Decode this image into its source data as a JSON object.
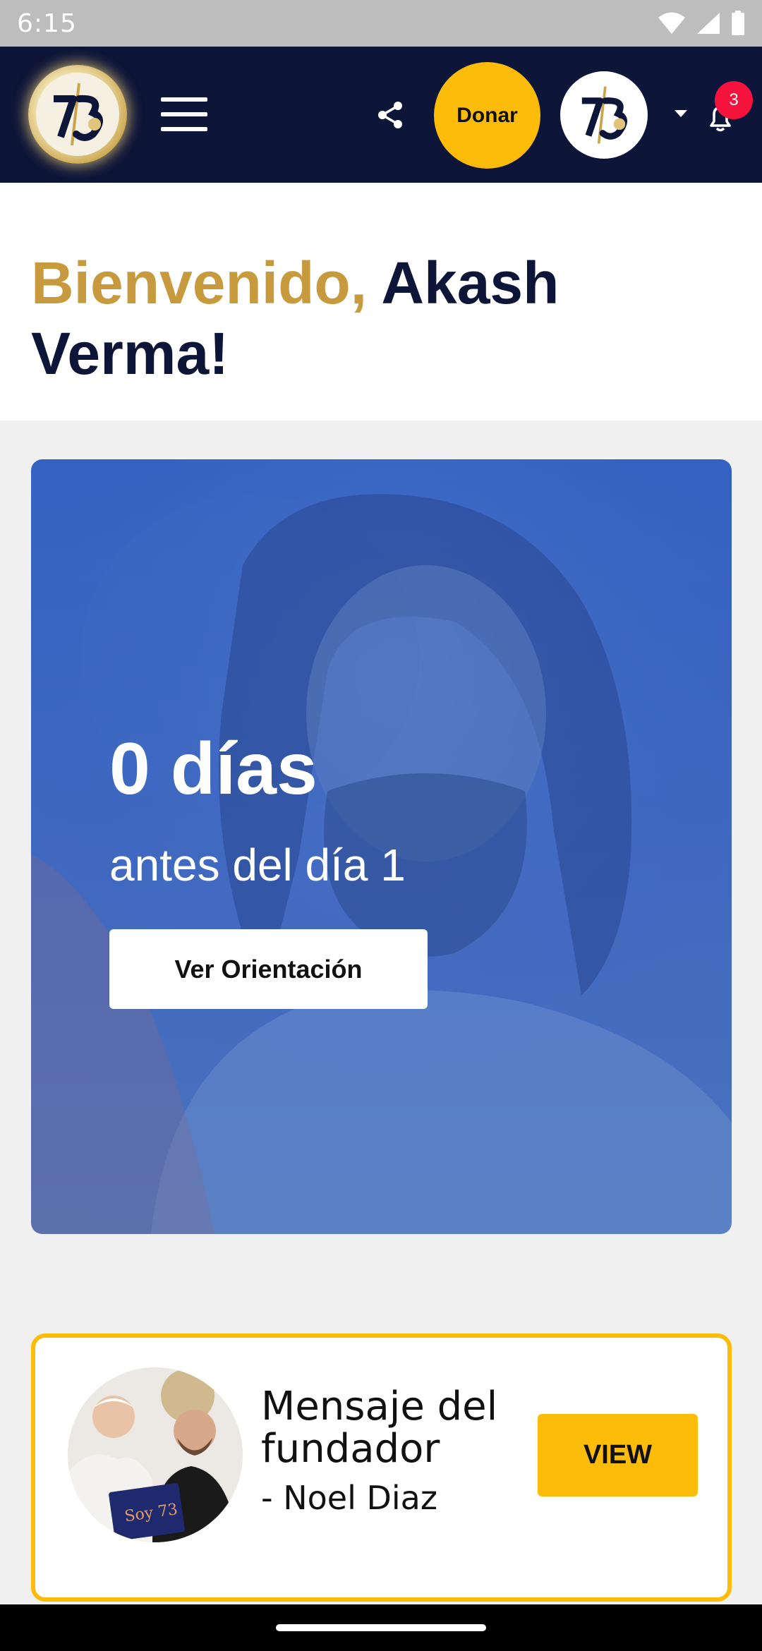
{
  "status_bar": {
    "time": "6:15",
    "icons": [
      "wifi-icon",
      "signal-icon",
      "battery-icon"
    ]
  },
  "header": {
    "logo_icon": "seventy-three-logo-icon",
    "menu_icon": "hamburger-menu-icon",
    "share_icon": "share-icon",
    "donate_label": "Donar",
    "avatar_icon": "seventy-three-avatar-icon",
    "notifications_icon": "bell-icon",
    "notifications_count": "3"
  },
  "welcome": {
    "greeting": "Bienvenido,",
    "name": "Akash Verma!"
  },
  "hero": {
    "days_label": "0 días",
    "subtitle": "antes del día 1",
    "button_label": "Ver Orientación"
  },
  "founder": {
    "title": "Mensaje del fundador",
    "author": "- Noel Diaz",
    "button_label": "VIEW",
    "photo_sign_text": "Soy 73"
  },
  "colors": {
    "header_bg": "#0d1538",
    "accent_gold": "#c79a3e",
    "donate_yellow": "#fdbb0a",
    "hero_blue": "#3461c2",
    "badge_red": "#f5123c"
  }
}
